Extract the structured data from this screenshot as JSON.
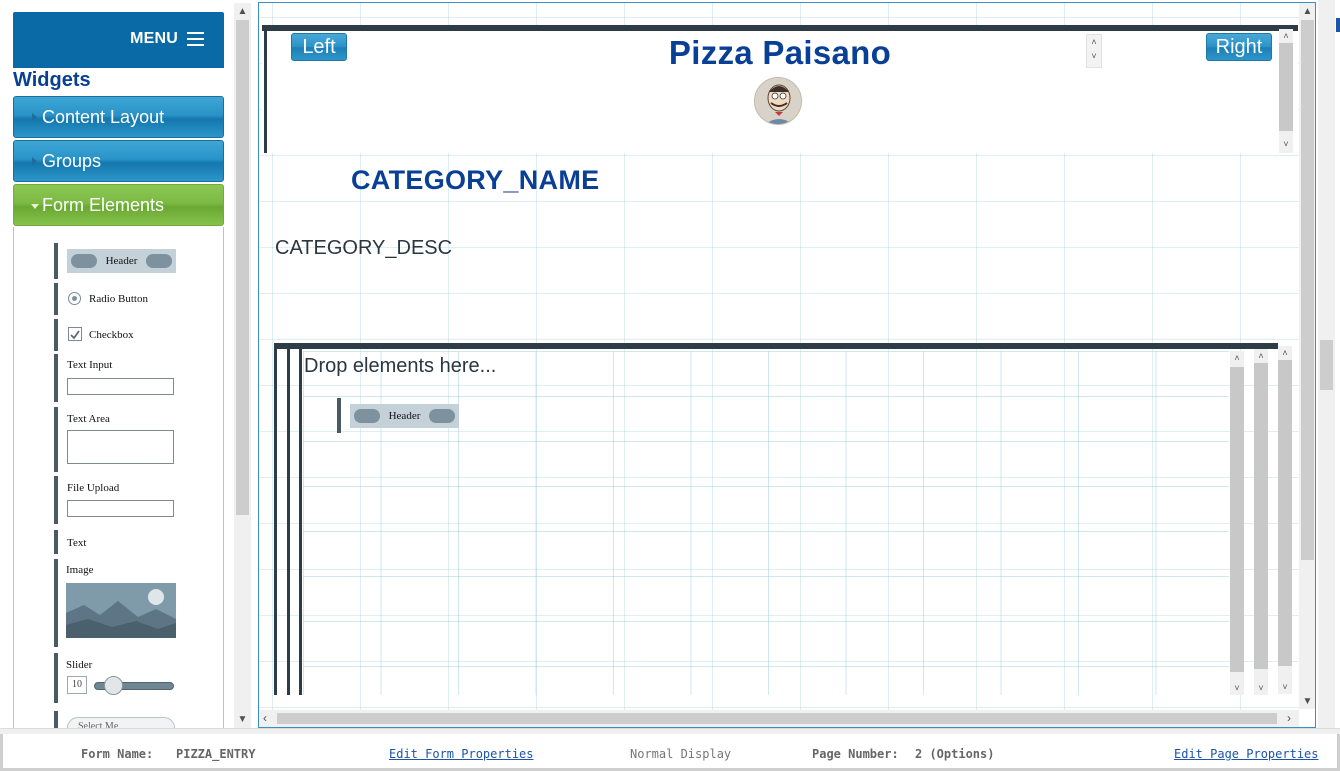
{
  "colors": {
    "brand_blue": "#0a6aa6",
    "title_navy": "#0a3f96",
    "accent_green": "#7cba44",
    "dark_bar": "#2d3c47"
  },
  "sidebar": {
    "menu_label": "MENU",
    "menu_icon": "hamburger-icon",
    "widgets_title": "Widgets",
    "accordion": [
      {
        "label": "Content Layout",
        "state": "collapsed"
      },
      {
        "label": "Groups",
        "state": "collapsed"
      },
      {
        "label": "Form Elements",
        "state": "expanded"
      }
    ],
    "form_elements": {
      "header": "Header",
      "radio": "Radio Button",
      "checkbox": "Checkbox",
      "text_input": "Text Input",
      "text_area": "Text Area",
      "file_upload": "File Upload",
      "text": "Text",
      "image": "Image",
      "slider": "Slider",
      "slider_value": "10",
      "select_menu": "Select Me"
    }
  },
  "canvas": {
    "left_button": "Left",
    "right_button": "Right",
    "site_title": "Pizza Paisano",
    "logo": "chef-caricature-logo",
    "category_name": "CATEGORY_NAME",
    "category_desc": "CATEGORY_DESC",
    "drop_prompt": "Drop elements here...",
    "dropped_header": "Header"
  },
  "status": {
    "form_name_label": "Form Name:",
    "form_name_value": "PIZZA_ENTRY",
    "edit_form_link": "Edit Form Properties",
    "display_mode": "Normal Display",
    "page_number_label": "Page Number:",
    "page_number_value": "2 (Options)",
    "edit_page_link": "Edit Page Properties"
  }
}
